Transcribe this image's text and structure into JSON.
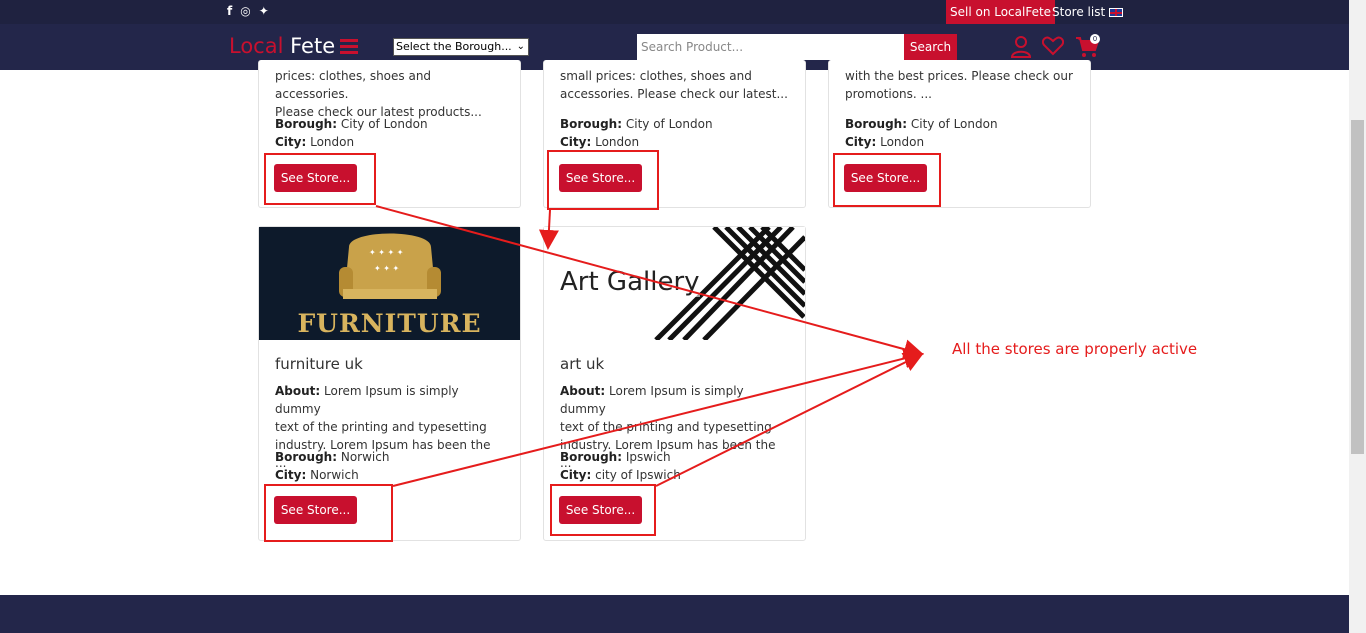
{
  "topbar": {
    "sell_label": "Sell on LocalFete",
    "store_list_label": "Store list"
  },
  "navbar": {
    "logo_part1": "Local",
    "logo_part2": "Fete",
    "borough_select": "Select the Borough...",
    "search_placeholder": "Search Product...",
    "search_button": "Search",
    "cart_count": "0"
  },
  "stores": [
    {
      "about_lines": [
        "prices: clothes, shoes and accessories.",
        "Please check our latest products..."
      ],
      "borough": "City of London",
      "city": "London",
      "button": "See Store..."
    },
    {
      "about_lines": [
        "small prices: clothes, shoes and",
        "accessories. Please check our latest..."
      ],
      "borough": "City of London",
      "city": "London",
      "button": "See Store..."
    },
    {
      "about_lines": [
        "with the best prices. Please check our",
        "promotions. ..."
      ],
      "borough": "City of London",
      "city": "London",
      "button": "See Store..."
    },
    {
      "name": "furniture uk",
      "image_text": "FURNITURE",
      "about_label": "About:",
      "about_lines": [
        "Lorem Ipsum is simply dummy",
        "text of the printing and typesetting",
        "industry. Lorem Ipsum has been the ..."
      ],
      "borough": "Norwich",
      "city": "Norwich",
      "button": "See Store..."
    },
    {
      "name": "art uk",
      "image_text": "Art Gallery",
      "about_label": "About:",
      "about_lines": [
        "Lorem Ipsum is simply dummy",
        "text of the printing and typesetting",
        "industry. Lorem Ipsum has been the ..."
      ],
      "borough": "Ipswich",
      "city": "city of Ipswich",
      "button": "See Store..."
    }
  ],
  "labels": {
    "borough": "Borough:",
    "city": "City:"
  },
  "annotation": {
    "text": "All the stores are properly active",
    "color": "#e51c1c"
  },
  "colors": {
    "accent": "#c8102e",
    "navbar": "#23264a"
  }
}
